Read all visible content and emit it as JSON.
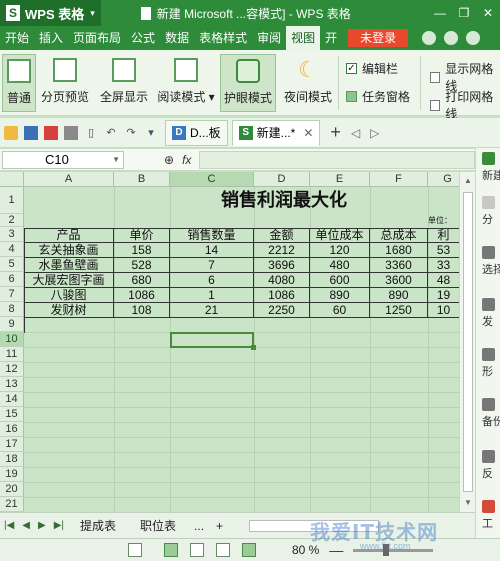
{
  "titlebar": {
    "app_name": "WPS 表格",
    "document_title": "新建 Microsoft ...容模式] - WPS 表格",
    "minimize": "—",
    "restore": "❐",
    "close": "✕"
  },
  "menubar": {
    "items": [
      "开始",
      "插入",
      "页面布局",
      "公式",
      "数据",
      "表格样式",
      "审阅",
      "视图",
      "开"
    ],
    "active_index": 7,
    "login_label": "未登录"
  },
  "ribbon": {
    "buttons": [
      {
        "label": "普通",
        "active": true
      },
      {
        "label": "分页预览",
        "active": false
      },
      {
        "label": "全屏显示",
        "active": false
      },
      {
        "label": "阅读模式 ▾",
        "active": false
      },
      {
        "label": "护眼模式",
        "active": true
      },
      {
        "label": "夜间模式",
        "active": false
      }
    ],
    "checks": [
      {
        "label": "编辑栏",
        "checked": true
      },
      {
        "label": "任务窗格",
        "checked": true
      },
      {
        "label": "显示网格线",
        "checked": false
      },
      {
        "label": "打印网格线",
        "checked": false
      }
    ]
  },
  "tabs": {
    "doc_tabs": [
      {
        "icon": "D",
        "label": "D...板"
      },
      {
        "icon": "S",
        "label": "新建...*"
      }
    ],
    "add_label": "+"
  },
  "formula": {
    "cell_ref": "C10",
    "fx_label": "fx",
    "zoom_glyph": "⊕"
  },
  "sheet": {
    "columns": [
      "A",
      "B",
      "C",
      "D",
      "E",
      "F",
      "G"
    ],
    "rows": [
      "1",
      "2",
      "3",
      "4",
      "5",
      "6",
      "7",
      "8",
      "9",
      "10",
      "11",
      "12",
      "13",
      "14",
      "15",
      "16",
      "17",
      "18",
      "19",
      "20",
      "21"
    ],
    "title": "销售利润最大化",
    "unit_note": "单位：",
    "headers": [
      "产品",
      "单价",
      "销售数量",
      "金额",
      "单位成本",
      "总成本",
      "利"
    ],
    "data_rows": [
      [
        "玄关抽象画",
        "158",
        "14",
        "2212",
        "120",
        "1680",
        "53"
      ],
      [
        "水墨鱼壁画",
        "528",
        "7",
        "3696",
        "480",
        "3360",
        "33"
      ],
      [
        "大展宏图字画",
        "680",
        "6",
        "4080",
        "600",
        "3600",
        "48"
      ],
      [
        "八骏图",
        "1086",
        "1",
        "1086",
        "890",
        "890",
        "19"
      ],
      [
        "发财树",
        "108",
        "21",
        "2250",
        "60",
        "1250",
        "10"
      ]
    ]
  },
  "task_panel": {
    "items": [
      "新建",
      "分",
      "选择",
      "发",
      "形",
      "备份",
      "反",
      "工"
    ]
  },
  "sheetbar": {
    "tabs": [
      "提成表",
      "职位表",
      "..."
    ],
    "add": "+"
  },
  "statusbar": {
    "zoom": "80 %",
    "zoom_minus": "—"
  },
  "watermark": {
    "text": "我爱IT技术网",
    "sub": "www.5it.com"
  }
}
